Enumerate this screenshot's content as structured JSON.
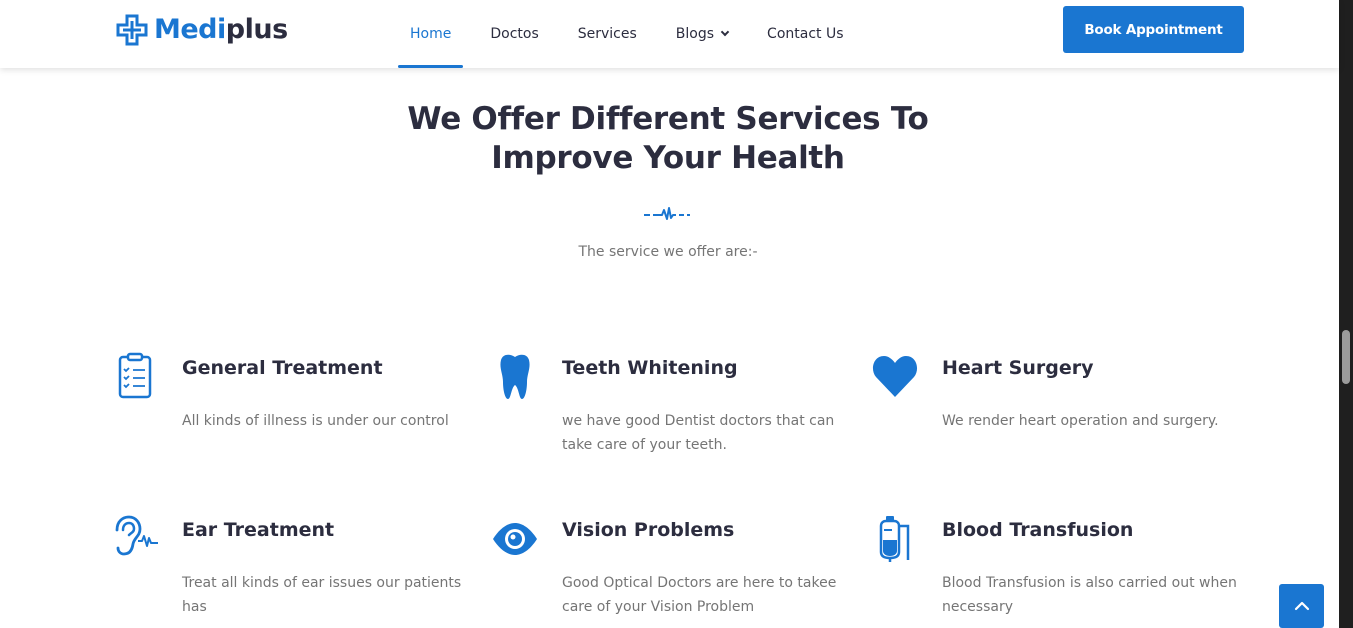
{
  "brand": {
    "name_part1": "Medi",
    "name_part2": "plus",
    "accent_color": "#1a76d1",
    "logo_icon": "medical-cross-icon"
  },
  "nav": {
    "items": [
      {
        "label": "Home",
        "active": true
      },
      {
        "label": "Doctos",
        "active": false
      },
      {
        "label": "Services",
        "active": false
      },
      {
        "label": "Blogs",
        "active": false,
        "has_dropdown": true
      },
      {
        "label": "Contact Us",
        "active": false
      }
    ],
    "cta": "Book Appointment"
  },
  "section": {
    "title_line1": "We Offer Different Services To",
    "title_line2": "Improve Your Health",
    "subtitle": "The service we offer are:-",
    "divider_icon": "heartbeat-pulse-icon"
  },
  "services": [
    {
      "icon": "clipboard-checklist-icon",
      "title": "General Treatment",
      "desc": "All kinds of illness is under our control"
    },
    {
      "icon": "tooth-icon",
      "title": "Teeth Whitening",
      "desc": "we have good Dentist doctors that can take care of your teeth."
    },
    {
      "icon": "heart-icon",
      "title": "Heart Surgery",
      "desc": "We render heart operation and surgery."
    },
    {
      "icon": "ear-icon",
      "title": "Ear Treatment",
      "desc": "Treat all kinds of ear issues our patients has"
    },
    {
      "icon": "eye-icon",
      "title": "Vision Problems",
      "desc": "Good Optical Doctors are here to takee care of your Vision Problem"
    },
    {
      "icon": "blood-bag-icon",
      "title": "Blood Transfusion",
      "desc": "Blood Transfusion is also carried out when necessary"
    }
  ],
  "scroll_to_top": {
    "icon": "chevron-up-icon"
  }
}
